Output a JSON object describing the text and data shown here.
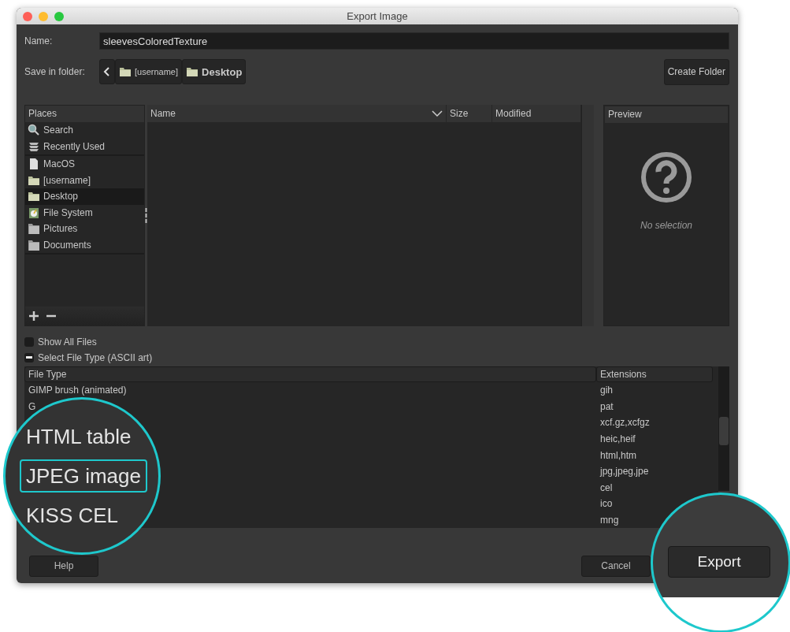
{
  "window": {
    "title": "Export Image"
  },
  "name_field": {
    "label": "Name:",
    "value": "sleevesColoredTexture"
  },
  "save_in_folder": {
    "label": "Save in folder:",
    "path": [
      {
        "label": "[username]",
        "selected": false
      },
      {
        "label": "Desktop",
        "selected": true
      }
    ],
    "create_folder": "Create Folder"
  },
  "places": {
    "header": "Places",
    "groups": [
      [
        {
          "label": "Search",
          "kind": "search",
          "selected": false
        },
        {
          "label": "Recently Used",
          "kind": "recent",
          "selected": false
        }
      ],
      [
        {
          "label": "MacOS",
          "kind": "document",
          "selected": false
        },
        {
          "label": "[username]",
          "kind": "folder",
          "selected": false
        },
        {
          "label": "Desktop",
          "kind": "folder",
          "selected": true
        },
        {
          "label": "File System",
          "kind": "disk",
          "selected": false
        },
        {
          "label": "Pictures",
          "kind": "gray-folder",
          "selected": false
        },
        {
          "label": "Documents",
          "kind": "gray-folder",
          "selected": false
        }
      ]
    ]
  },
  "file_list": {
    "columns": [
      "Name",
      "Size",
      "Modified"
    ]
  },
  "preview": {
    "header": "Preview",
    "message": "No selection"
  },
  "show_all_files": {
    "label": "Show All Files",
    "checked": false
  },
  "file_type": {
    "label": "Select File Type (ASCII art)",
    "expanded": true,
    "columns": [
      "File Type",
      "Extensions"
    ],
    "rows": [
      {
        "name": "GIMP brush (animated)",
        "extensions": "gih"
      },
      {
        "name": "G",
        "extensions": "pat"
      },
      {
        "extensions": "xcf.gz,xcfgz"
      },
      {
        "extensions": "heic,heif"
      },
      {
        "extensions": "html,htm"
      },
      {
        "extensions": "jpg,jpeg,jpe"
      },
      {
        "extensions": "cel"
      },
      {
        "extensions": "ico"
      },
      {
        "extensions": "mng"
      }
    ]
  },
  "buttons": {
    "help": "Help",
    "cancel": "Cancel"
  },
  "magnifiers": [
    {
      "lines": [
        {
          "text": "HTML table",
          "selected": false
        },
        {
          "text": "JPEG image",
          "selected": true
        },
        {
          "text": "KISS CEL",
          "selected": false
        }
      ]
    },
    {
      "button": "Export"
    }
  ]
}
